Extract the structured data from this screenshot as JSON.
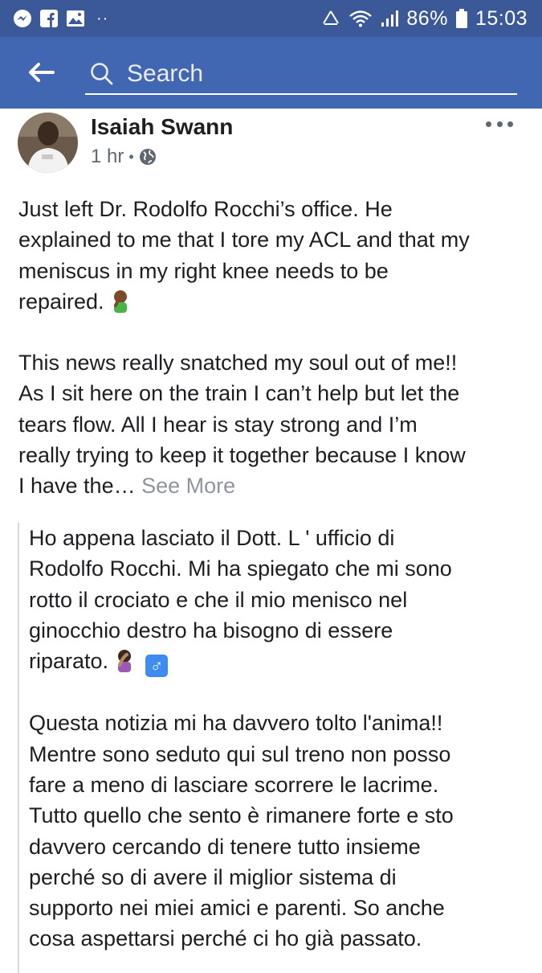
{
  "status_bar": {
    "battery": "86%",
    "time": "15:03",
    "left_icons": [
      "messenger-icon",
      "facebook-icon",
      "gallery-icon"
    ],
    "right_icons": [
      "recycle-icon",
      "wifi-icon",
      "signal-icon",
      "battery-icon"
    ],
    "bg_color": "#3b5998"
  },
  "header": {
    "search_placeholder": "Search",
    "bg_color": "#4267b2"
  },
  "post": {
    "author": "Isaiah Swann",
    "time": "1 hr",
    "privacy_icon": "globe-icon",
    "body_para1_lines": [
      "Just left Dr. Rodolfo Rocchi’s office. He",
      "explained to me that I tore my ACL and that my",
      "meniscus in my right knee needs to be",
      "repaired."
    ],
    "body_para2_lines": [
      "This news really snatched my soul out of me!!",
      "As I sit here on the train I can’t help but let the",
      "tears flow. All I hear is stay strong and I’m",
      "really trying to keep it together because I know",
      "I have the…"
    ],
    "see_more": "See More",
    "translation_para1_lines": [
      "Ho appena lasciato il Dott. L ' ufficio di",
      "Rodolfo Rocchi. Mi ha spiegato che mi sono",
      "rotto il crociato e che il mio menisco nel",
      "ginocchio destro ha bisogno di essere",
      "riparato."
    ],
    "translation_para2_lines": [
      "Questa notizia mi ha davvero tolto l'anima!!",
      "Mentre sono seduto qui sul treno non posso",
      "fare a meno di lasciare scorrere le lacrime.",
      "Tutto quello che sento è rimanere forte e sto",
      "davvero cercando di tenere tutto insieme",
      "perché so di avere il miglior sistema di",
      "supporto nei miei amici e parenti. So anche",
      "cosa aspettarsi perché ci ho già passato."
    ],
    "male_sign": "♂",
    "link_color": "#90949c"
  }
}
